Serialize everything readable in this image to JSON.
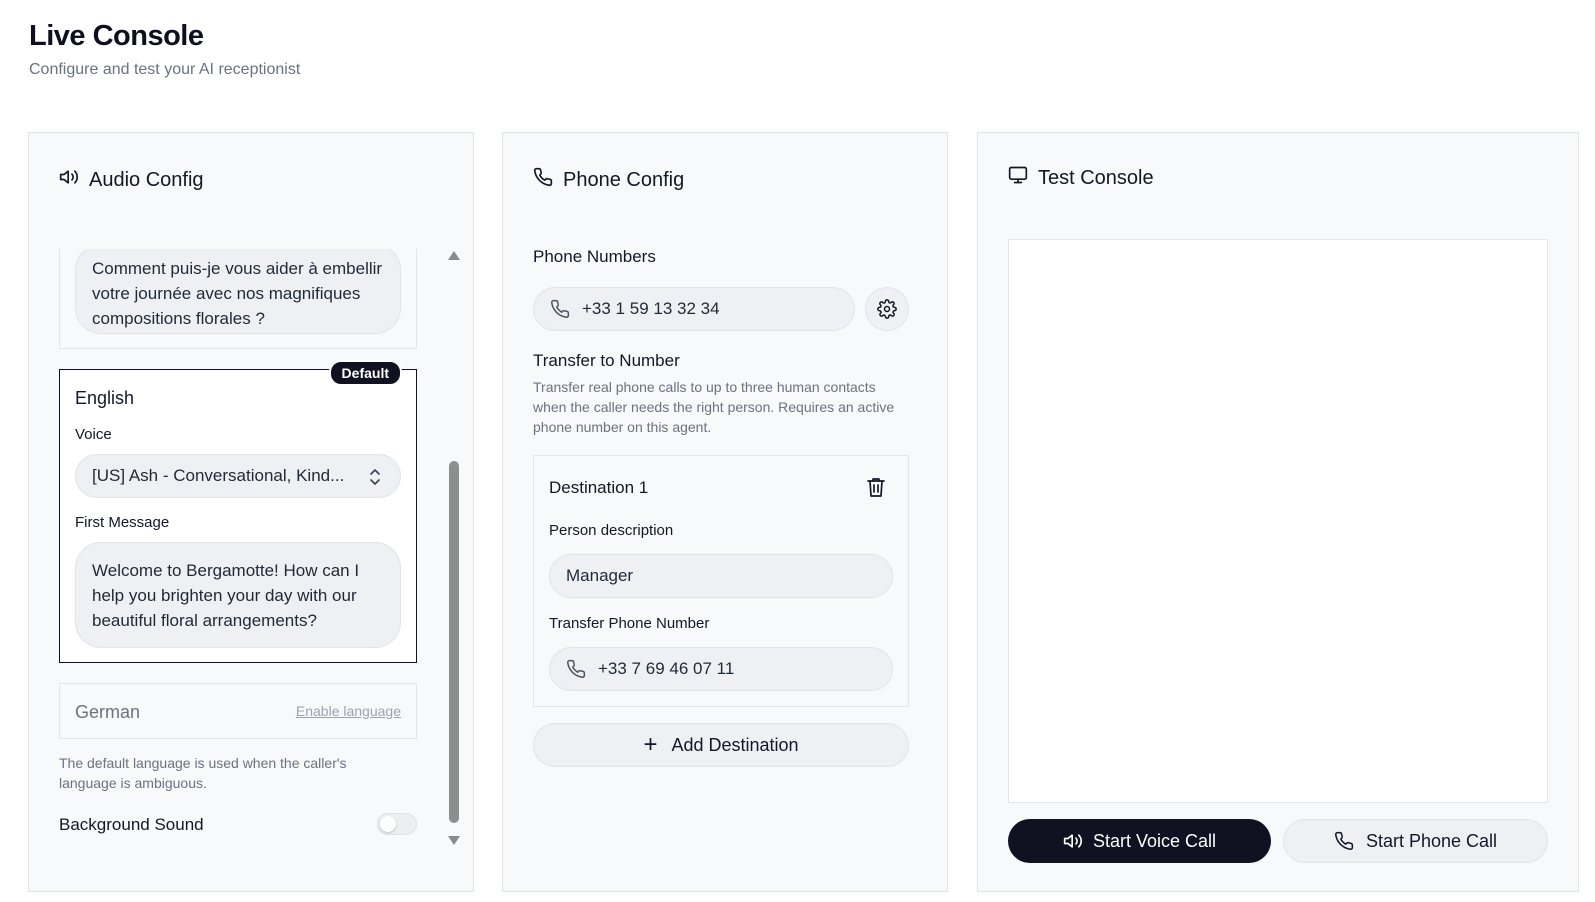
{
  "page": {
    "title": "Live Console",
    "subtitle": "Configure and test your AI receptionist"
  },
  "audio_config": {
    "header": "Audio Config",
    "french_first_message": "Comment puis-je vous aider à embellir votre journée avec nos magnifiques compositions florales ?",
    "english": {
      "badge": "Default",
      "language": "English",
      "voice_label": "Voice",
      "voice_value": "[US] Ash - Conversational, Kind...",
      "first_message_label": "First Message",
      "first_message": "Welcome to Bergamotte! How can I help you brighten your day with our beautiful floral arrangements?"
    },
    "german": {
      "language": "German",
      "enable_link": "Enable language"
    },
    "default_language_help": "The default language is used when the caller's language is ambiguous.",
    "background_sound_label": "Background Sound",
    "background_sound_enabled": false
  },
  "phone_config": {
    "header": "Phone Config",
    "phone_numbers_label": "Phone Numbers",
    "phone_number": "+33 1 59 13 32 34",
    "transfer_label": "Transfer to Number",
    "transfer_help": "Transfer real phone calls to up to three human contacts when the caller needs the right person. Requires an active phone number on this agent.",
    "destinations": [
      {
        "title": "Destination 1",
        "person_description_label": "Person description",
        "person_description": "Manager",
        "transfer_number_label": "Transfer Phone Number",
        "transfer_number": "+33 7 69 46 07 11"
      }
    ],
    "add_destination_label": "Add Destination"
  },
  "test_console": {
    "header": "Test Console",
    "start_voice_call": "Start Voice Call",
    "start_phone_call": "Start Phone Call"
  },
  "colors": {
    "primary": "#111122",
    "panel_bg": "#f8f9fb",
    "field_bg": "#eef0f4",
    "muted_text": "#6b7280"
  },
  "icons": [
    "speaker-icon",
    "phone-icon",
    "monitor-icon",
    "gear-icon",
    "trash-icon",
    "plus-icon",
    "chevron-updown-icon"
  ]
}
